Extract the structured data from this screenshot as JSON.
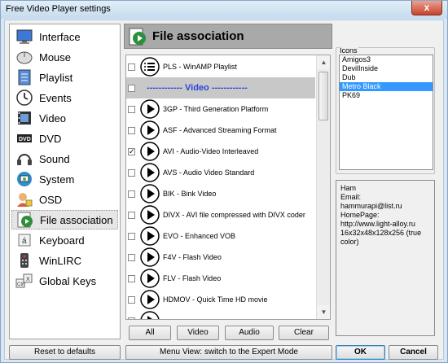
{
  "window": {
    "title": "Free Video Player settings",
    "close_glyph": "x"
  },
  "sidebar": {
    "items": [
      {
        "label": "Interface",
        "icon": "monitor-icon"
      },
      {
        "label": "Mouse",
        "icon": "mouse-icon"
      },
      {
        "label": "Playlist",
        "icon": "playlist-icon"
      },
      {
        "label": "Events",
        "icon": "clock-icon"
      },
      {
        "label": "Video",
        "icon": "film-icon"
      },
      {
        "label": "DVD",
        "icon": "dvd-icon"
      },
      {
        "label": "Sound",
        "icon": "headphones-icon"
      },
      {
        "label": "System",
        "icon": "system-icon"
      },
      {
        "label": "OSD",
        "icon": "osd-icon"
      },
      {
        "label": "File association",
        "icon": "file-association-icon",
        "selected": true
      },
      {
        "label": "Keyboard",
        "icon": "keyboard-icon"
      },
      {
        "label": "WinLIRC",
        "icon": "remote-icon"
      },
      {
        "label": "Global Keys",
        "icon": "global-keys-icon"
      }
    ]
  },
  "main": {
    "title": "File association",
    "rows": [
      {
        "type": "item",
        "icon": "list-icon",
        "label": "PLS - WinAMP Playlist",
        "checked": false
      },
      {
        "type": "group",
        "label": "------------ Video ------------"
      },
      {
        "type": "item",
        "label": "3GP - Third Generation Platform",
        "checked": false
      },
      {
        "type": "item",
        "label": "ASF - Advanced Streaming Format",
        "checked": false
      },
      {
        "type": "item",
        "label": "AVI - Audio-Video Interleaved",
        "checked": true
      },
      {
        "type": "item",
        "label": "AVS - Audio Video Standard",
        "checked": false
      },
      {
        "type": "item",
        "label": "BIK - Bink Video",
        "checked": false
      },
      {
        "type": "item",
        "label": "DIVX - AVI file compressed with DIVX coder",
        "checked": false
      },
      {
        "type": "item",
        "label": "EVO - Enhanced VOB",
        "checked": false
      },
      {
        "type": "item",
        "label": "F4V - Flash Video",
        "checked": false
      },
      {
        "type": "item",
        "label": "FLV - Flash Video",
        "checked": false
      },
      {
        "type": "item",
        "label": "HDMOV - Quick Time HD movie",
        "checked": false
      }
    ],
    "buttons": {
      "all": "All",
      "video": "Video",
      "audio": "Audio",
      "clear": "Clear"
    }
  },
  "icons_panel": {
    "label": "Icons",
    "items": [
      "Amigos3",
      "DevilInside",
      "Dub",
      "Metro Black",
      "PK69"
    ],
    "selected": "Metro Black"
  },
  "info": {
    "author": "Ham",
    "email_label": "Email:",
    "email": "hammurapi@list.ru",
    "homepage_label": "HomePage:",
    "homepage": "http://www.light-alloy.ru",
    "sizes": "16x32x48x128x256 (true color)"
  },
  "footer": {
    "reset": "Reset to defaults",
    "menu_view": "Menu View: switch to the Expert Mode",
    "ok": "OK",
    "cancel": "Cancel"
  }
}
